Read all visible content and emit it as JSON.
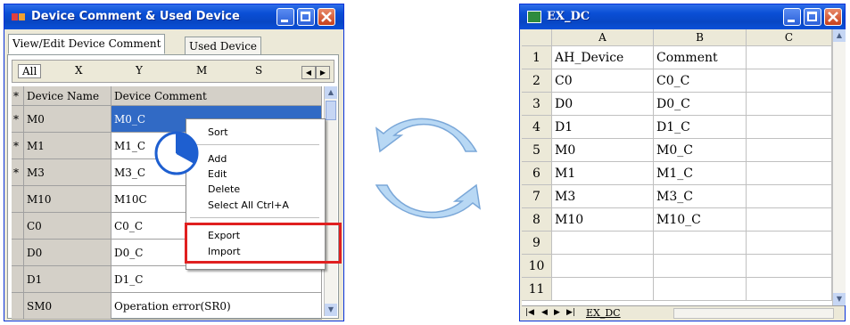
{
  "left_window": {
    "title": "Device Comment & Used Device",
    "tabs": [
      "View/Edit Device Comment",
      "Used Device"
    ],
    "filter_tabs": [
      "All",
      "X",
      "Y",
      "M",
      "S"
    ],
    "columns": [
      "*",
      "Device Name",
      "Device Comment"
    ],
    "rows": [
      {
        "star": "*",
        "name": "M0",
        "comment": "M0_C"
      },
      {
        "star": "*",
        "name": "M1",
        "comment": "M1_C"
      },
      {
        "star": "*",
        "name": "M3",
        "comment": "M3_C"
      },
      {
        "star": "",
        "name": "M10",
        "comment": "M10C"
      },
      {
        "star": "",
        "name": "C0",
        "comment": "C0_C"
      },
      {
        "star": "",
        "name": "D0",
        "comment": "D0_C"
      },
      {
        "star": "",
        "name": "D1",
        "comment": "D1_C"
      },
      {
        "star": "",
        "name": "SM0",
        "comment": "Operation error(SR0)"
      }
    ]
  },
  "context_menu": {
    "items": [
      "Sort",
      "Add",
      "Edit",
      "Delete",
      "Select All  Ctrl+A",
      "Export",
      "Import"
    ]
  },
  "right_window": {
    "title": "EX_DC",
    "columns": [
      "A",
      "B",
      "C"
    ],
    "rows": [
      {
        "n": "1",
        "a": "AH_Device",
        "b": "Comment"
      },
      {
        "n": "2",
        "a": "C0",
        "b": "C0_C"
      },
      {
        "n": "3",
        "a": "D0",
        "b": "D0_C"
      },
      {
        "n": "4",
        "a": "D1",
        "b": "D1_C"
      },
      {
        "n": "5",
        "a": "M0",
        "b": "M0_C"
      },
      {
        "n": "6",
        "a": "M1",
        "b": "M1_C"
      },
      {
        "n": "7",
        "a": "M3",
        "b": "M3_C"
      },
      {
        "n": "8",
        "a": "M10",
        "b": "M10_C"
      },
      {
        "n": "9",
        "a": "",
        "b": ""
      },
      {
        "n": "10",
        "a": "",
        "b": ""
      },
      {
        "n": "11",
        "a": "",
        "b": ""
      }
    ],
    "sheet_tab": "EX_DC"
  },
  "colors": {
    "highlight_box": "#e02020",
    "arrow": "#9cc8f0",
    "title_blue": "#0a4fd6"
  }
}
